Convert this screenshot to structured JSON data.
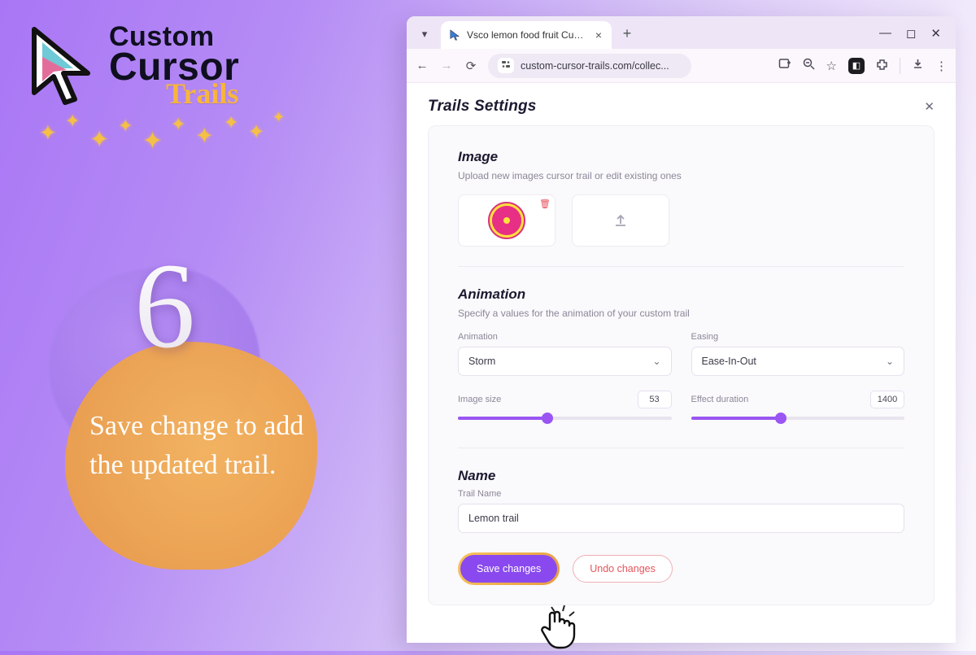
{
  "promo": {
    "logo_line1": "Custom",
    "logo_line2": "Cursor",
    "logo_tag": "Trails",
    "step_number": "6",
    "copy": "Save change to add the updated trail."
  },
  "browser": {
    "tab_title": "Vsco lemon food fruit Custom C",
    "url": "custom-cursor-trails.com/collec..."
  },
  "page": {
    "title": "Trails Settings",
    "image": {
      "heading": "Image",
      "sub": "Upload new images cursor trail or edit existing ones"
    },
    "animation": {
      "heading": "Animation",
      "sub": "Specify a values for the animation of your custom trail",
      "anim_label": "Animation",
      "anim_value": "Storm",
      "easing_label": "Easing",
      "easing_value": "Ease-In-Out",
      "size_label": "Image size",
      "size_value": "53",
      "duration_label": "Effect duration",
      "duration_value": "1400"
    },
    "name": {
      "heading": "Name",
      "label": "Trail Name",
      "value": "Lemon trail"
    },
    "buttons": {
      "save": "Save changes",
      "undo": "Undo changes"
    }
  }
}
